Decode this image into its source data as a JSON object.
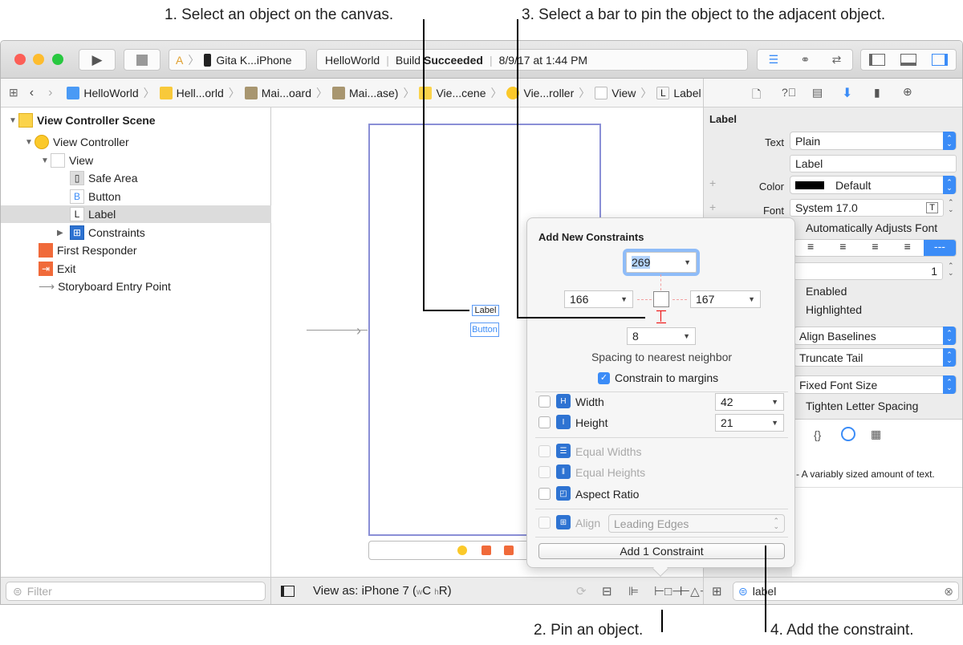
{
  "callouts": {
    "c1": "1. Select an object on the canvas.",
    "c2": "2. Pin an object.",
    "c3": "3. Select a bar to pin the object to the adjacent object.",
    "c4": "4. Add the constraint."
  },
  "toolbar": {
    "scheme": "Gita K...iPhone",
    "activity_project": "HelloWorld",
    "activity_build": "Build",
    "activity_status": "Succeeded",
    "activity_time": "8/9/17 at 1:44 PM"
  },
  "breadcrumb": [
    "HelloWorld",
    "Hell...orld",
    "Mai...oard",
    "Mai...ase)",
    "Vie...cene",
    "Vie...roller",
    "View",
    "Label"
  ],
  "navigator": {
    "items": [
      {
        "label": "View Controller Scene",
        "icon": "scene-icon"
      },
      {
        "label": "View Controller",
        "icon": "view-controller-icon"
      },
      {
        "label": "View",
        "icon": "view-icon"
      },
      {
        "label": "Safe Area",
        "icon": "safe-area-icon"
      },
      {
        "label": "Button",
        "icon": "button-icon",
        "glyph": "B"
      },
      {
        "label": "Label",
        "icon": "label-icon",
        "glyph": "L"
      },
      {
        "label": "Constraints",
        "icon": "constraints-icon"
      },
      {
        "label": "First Responder",
        "icon": "first-responder-icon"
      },
      {
        "label": "Exit",
        "icon": "exit-icon"
      },
      {
        "label": "Storyboard Entry Point",
        "icon": "arrow-icon"
      }
    ],
    "filter_placeholder": "Filter"
  },
  "canvas": {
    "label_text": "Label",
    "button_text": "Button",
    "view_as": "View as: iPhone 7 (",
    "w": "w",
    "c": "C",
    "h": "h",
    "r": "R)"
  },
  "inspector": {
    "title": "Label",
    "text_label": "Text",
    "text_value": "Plain",
    "label_value": "Label",
    "color_label": "Color",
    "color_value": "Default",
    "font_label": "Font",
    "font_value": "System 17.0",
    "auto_adjust": "Automatically Adjusts Font",
    "lines": "1",
    "enabled": "Enabled",
    "highlighted": "Highlighted",
    "baseline": "Align Baselines",
    "line_break": "Truncate Tail",
    "autoshrink": "Fixed Font Size",
    "tighten": "Tighten Letter Spacing",
    "align_more": "---",
    "description": "- A variably sized amount of text.",
    "search_value": "label",
    "accent": "#3b8cf7"
  },
  "popover": {
    "title": "Add New Constraints",
    "top": "269",
    "left": "166",
    "right": "167",
    "bottom": "8",
    "spacing_label": "Spacing to nearest neighbor",
    "margins_label": "Constrain to margins",
    "width_label": "Width",
    "width_value": "42",
    "height_label": "Height",
    "height_value": "21",
    "equal_widths": "Equal Widths",
    "equal_heights": "Equal Heights",
    "aspect_ratio": "Aspect Ratio",
    "align_label": "Align",
    "align_value": "Leading Edges",
    "add_button": "Add 1 Constraint"
  }
}
